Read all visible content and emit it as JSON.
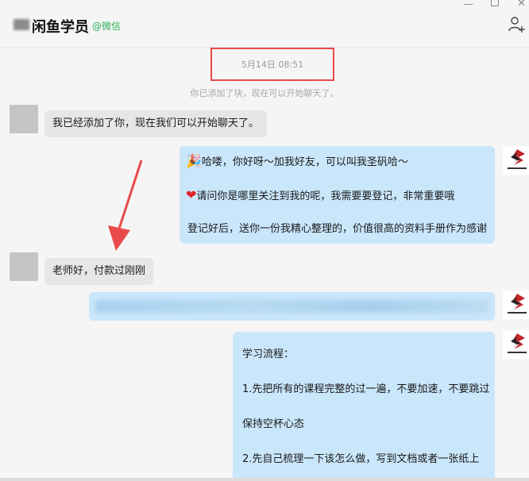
{
  "header": {
    "name": "闲鱼学员",
    "source": "@微信"
  },
  "window_controls": {
    "minimize": "—",
    "close": "✕"
  },
  "chat": {
    "timestamp": "5月14日 08:51",
    "system_message": "你已添加了块，现在可以开始聊天了。",
    "messages": [
      {
        "side": "in",
        "text": "我已经添加了你，现在我们可以开始聊天了。"
      },
      {
        "side": "out",
        "lines": [
          "哈喽，你好呀～加我好友，可以叫我圣矾哈～",
          "请问你是哪里关注到我的呢，我需要要登记，非常重要哦",
          "登记好后，送你一份我精心整理的，价值很高的资料手册作为感谢"
        ]
      },
      {
        "side": "in",
        "text": "老师好，付款过刚刚"
      },
      {
        "side": "out",
        "blurred": true
      },
      {
        "side": "out",
        "lines": [
          "学习流程：",
          "1.先把所有的课程完整的过一遍，不要加速，不要跳过",
          "保持空杯心态",
          "2.先自己梳理一下该怎么做，写到文档或者一张纸上"
        ]
      }
    ]
  },
  "colors": {
    "outgoing_bubble": "#c9e6fb",
    "incoming_bubble": "#e6e6e6",
    "highlight_box": "#e84a4a",
    "arrow": "#e84a4a",
    "source_tag": "#2fb35a"
  },
  "icons": [
    "add-user-icon",
    "party-popper-icon",
    "heart-icon",
    "brand-logo-icon"
  ]
}
